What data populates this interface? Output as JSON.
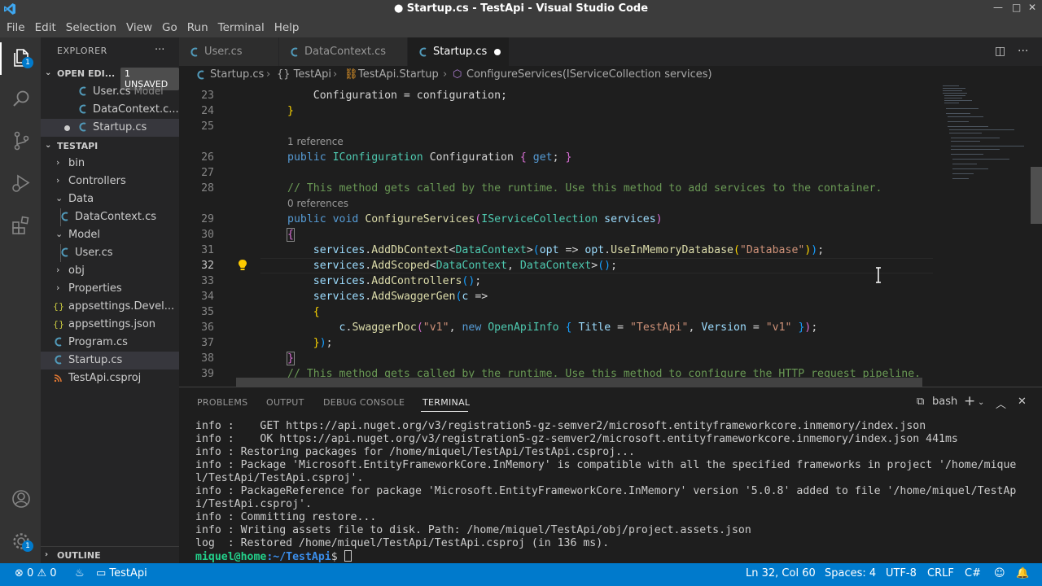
{
  "window": {
    "title": "● Startup.cs - TestApi - Visual Studio Code"
  },
  "menubar": [
    "File",
    "Edit",
    "Selection",
    "View",
    "Go",
    "Run",
    "Terminal",
    "Help"
  ],
  "activitybar": {
    "explorer_badge": "1"
  },
  "sidebar": {
    "header": "EXPLORER",
    "open_editors": {
      "title": "OPEN EDI...",
      "badge": "1 UNSAVED",
      "items": [
        {
          "label": "User.cs",
          "description": "Model"
        },
        {
          "label": "DataContext.c..."
        },
        {
          "label": "Startup.cs"
        }
      ]
    },
    "project": {
      "title": "TESTAPI",
      "items": [
        {
          "label": "bin"
        },
        {
          "label": "Controllers"
        },
        {
          "label": "Data"
        },
        {
          "label": "DataContext.cs"
        },
        {
          "label": "Model"
        },
        {
          "label": "User.cs"
        },
        {
          "label": "obj"
        },
        {
          "label": "Properties"
        },
        {
          "label": "appsettings.Devel..."
        },
        {
          "label": "appsettings.json"
        },
        {
          "label": "Program.cs"
        },
        {
          "label": "Startup.cs"
        },
        {
          "label": "TestApi.csproj"
        }
      ]
    },
    "outline": "OUTLINE"
  },
  "tabs": [
    {
      "label": "User.cs"
    },
    {
      "label": "DataContext.cs"
    },
    {
      "label": "Startup.cs"
    }
  ],
  "breadcrumb": [
    "Startup.cs",
    "{} TestApi",
    "TestApi.Startup",
    "ConfigureServices(IServiceCollection services)"
  ],
  "editor": {
    "line_numbers": [
      "23",
      "24",
      "25",
      "26",
      "27",
      "28",
      "29",
      "30",
      "31",
      "32",
      "33",
      "34",
      "35",
      "36",
      "37",
      "38",
      "39"
    ],
    "codelens": [
      "1 reference",
      "0 references"
    ]
  },
  "panel": {
    "tabs": [
      "PROBLEMS",
      "OUTPUT",
      "DEBUG CONSOLE",
      "TERMINAL"
    ],
    "shell": "bash",
    "terminal_lines": [
      "info :    GET https://api.nuget.org/v3/registration5-gz-semver2/microsoft.entityframeworkcore.inmemory/index.json",
      "info :    OK https://api.nuget.org/v3/registration5-gz-semver2/microsoft.entityframeworkcore.inmemory/index.json 441ms",
      "info : Restoring packages for /home/miquel/TestApi/TestApi.csproj...",
      "info : Package 'Microsoft.EntityFrameworkCore.InMemory' is compatible with all the specified frameworks in project '/home/mique",
      "l/TestApi/TestApi.csproj'.",
      "info : PackageReference for package 'Microsoft.EntityFrameworkCore.InMemory' version '5.0.8' added to file '/home/miquel/TestAp",
      "i/TestApi.csproj'.",
      "info : Committing restore...",
      "info : Writing assets file to disk. Path: /home/miquel/TestApi/obj/project.assets.json",
      "log  : Restored /home/miquel/TestApi/TestApi.csproj (in 136 ms)."
    ],
    "prompt_user": "miquel@home",
    "prompt_path": ":~/TestApi",
    "prompt_symbol": "$ "
  },
  "statusbar": {
    "errors": "0",
    "warnings": "0",
    "project": "TestApi",
    "position": "Ln 32, Col 60",
    "spaces": "Spaces: 4",
    "encoding": "UTF-8",
    "eol": "CRLF",
    "language": "C#"
  },
  "colors": {
    "accent": "#007acc",
    "titlebar": "#3c3c3c",
    "editor_bg": "#1e1e1e",
    "sidebar_bg": "#252526"
  }
}
